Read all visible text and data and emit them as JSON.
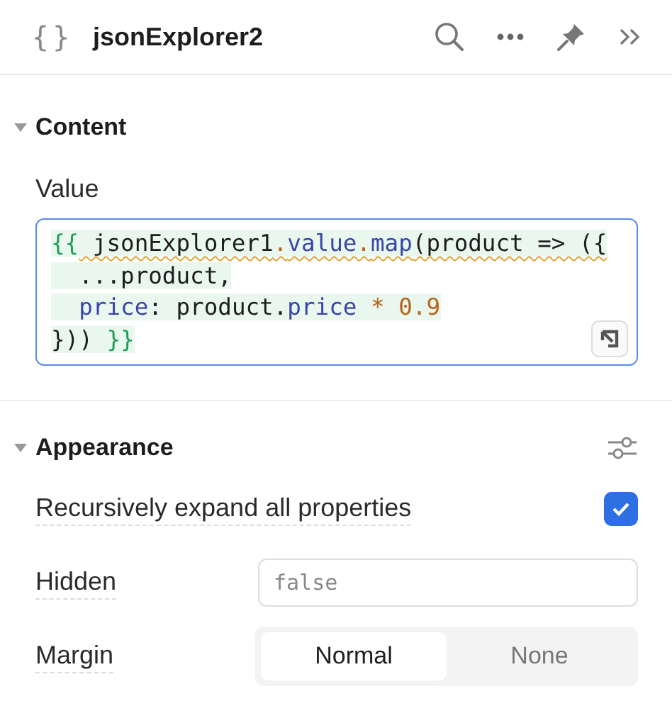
{
  "header": {
    "icon": "{}",
    "title": "jsonExplorer2"
  },
  "sections": [
    {
      "title": "Content",
      "expanded": true,
      "settings_icon": false,
      "rows": [
        {
          "kind": "code",
          "label": "Value",
          "lines": [
            [
              {
                "text": "{{",
                "kind": "brace",
                "warning": false
              },
              {
                "text": " jsonExplorer1",
                "kind": "plain",
                "warning": true
              },
              {
                "text": ".",
                "kind": "op",
                "warning": true
              },
              {
                "text": "value",
                "kind": "prop",
                "warning": true
              },
              {
                "text": ".",
                "kind": "op",
                "warning": true
              },
              {
                "text": "map",
                "kind": "prop",
                "warning": true
              },
              {
                "text": "(product => ({",
                "kind": "plain",
                "warning": true
              }
            ],
            [
              {
                "text": "  ...product,",
                "kind": "plain",
                "warning": false
              }
            ],
            [
              {
                "text": "  price",
                "kind": "prop",
                "warning": false
              },
              {
                "text": ": product.",
                "kind": "plain",
                "warning": false
              },
              {
                "text": "price ",
                "kind": "prop",
                "warning": false
              },
              {
                "text": "* ",
                "kind": "op",
                "warning": false
              },
              {
                "text": "0.9",
                "kind": "num",
                "warning": false
              }
            ],
            [
              {
                "text": "})) ",
                "kind": "plain",
                "warning": false
              },
              {
                "text": "}}",
                "kind": "brace",
                "warning": false
              }
            ]
          ]
        }
      ]
    },
    {
      "title": "Appearance",
      "expanded": true,
      "settings_icon": true,
      "rows": [
        {
          "kind": "checkbox",
          "label": "Recursively expand all properties",
          "checked": true
        },
        {
          "kind": "input",
          "label": "Hidden",
          "placeholder": "false"
        },
        {
          "kind": "segmented",
          "label": "Margin",
          "options": [
            {
              "label": "Normal",
              "selected": true
            },
            {
              "label": "None",
              "selected": false
            }
          ]
        }
      ]
    }
  ]
}
